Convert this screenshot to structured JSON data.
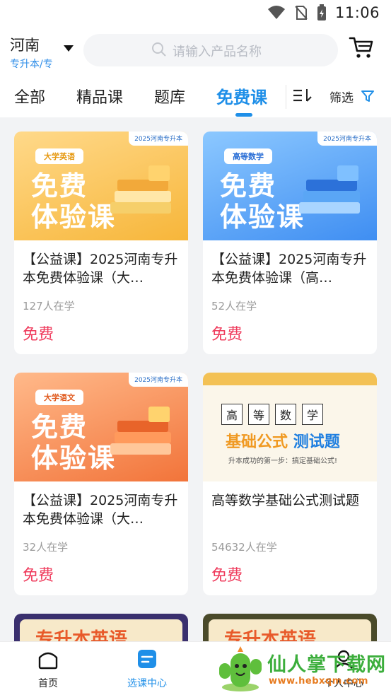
{
  "status_bar": {
    "time": "11:06"
  },
  "header": {
    "city": "河南",
    "city_sub": "专升本/专",
    "search_placeholder": "请输入产品名称"
  },
  "tabs": {
    "items": [
      "全部",
      "精品课",
      "题库",
      "免费课"
    ],
    "active": "免费课",
    "filter_label": "筛选"
  },
  "courses": [
    {
      "thumb_subject": "大学英语",
      "thumb_line1": "免费",
      "thumb_line2": "体验课",
      "brand": "2025河南专升本",
      "title": "【公益课】2025河南专升本免费体验课（大…",
      "learners": "127人在学",
      "price": "免费"
    },
    {
      "thumb_subject": "高等数学",
      "thumb_line1": "免费",
      "thumb_line2": "体验课",
      "brand": "2025河南专升本",
      "title": "【公益课】2025河南专升本免费体验课（高…",
      "learners": "52人在学",
      "price": "免费"
    },
    {
      "thumb_subject": "大学语文",
      "thumb_line1": "免费",
      "thumb_line2": "体验课",
      "brand": "2025河南专升本",
      "title": "【公益课】2025河南专升本免费体验课（大…",
      "learners": "32人在学",
      "price": "免费"
    },
    {
      "thumb_chars": [
        "高",
        "等",
        "数",
        "学"
      ],
      "thumb_line1": "基础公式",
      "thumb_line1b": "测试题",
      "thumb_tagline": "升本成功的第一步：搞定基础公式!",
      "title": "高等数学基础公式测试题",
      "learners": "54632人在学",
      "price": "免费"
    }
  ],
  "peek_cards": [
    {
      "text": "专升本英语"
    },
    {
      "text": "专升本英语"
    }
  ],
  "bottom_nav": {
    "items": [
      {
        "label": "首页",
        "icon": "home-icon"
      },
      {
        "label": "选课中心",
        "icon": "course-center-icon"
      },
      {
        "label": "个人中心",
        "icon": "profile-icon"
      }
    ],
    "active": "选课中心"
  },
  "watermark": {
    "text": "仙人掌下载网",
    "url": "www.hebxqm.com"
  },
  "colors": {
    "accent": "#1f8fe8",
    "price": "#ef3b5c",
    "background": "#f2f3f5"
  }
}
